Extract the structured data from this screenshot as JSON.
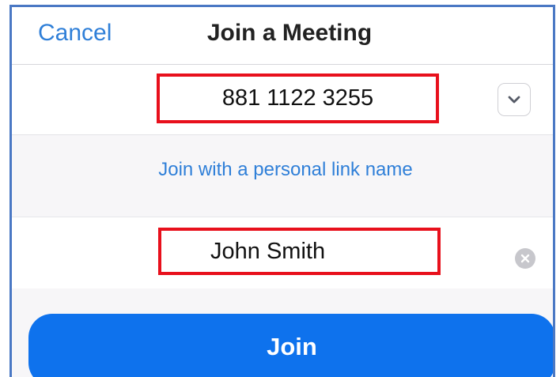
{
  "header": {
    "cancel_label": "Cancel",
    "title": "Join a Meeting"
  },
  "meeting_id": {
    "value": "881 1122 3255",
    "dropdown_icon": "chevron-down-icon"
  },
  "personal_link": {
    "label": "Join with a personal link name"
  },
  "display_name": {
    "value": "John Smith",
    "clear_icon": "clear-icon"
  },
  "join_button": {
    "label": "Join"
  },
  "colors": {
    "accent": "#2f7fd8",
    "join_button": "#0e72ed",
    "highlight": "#e8101c"
  }
}
